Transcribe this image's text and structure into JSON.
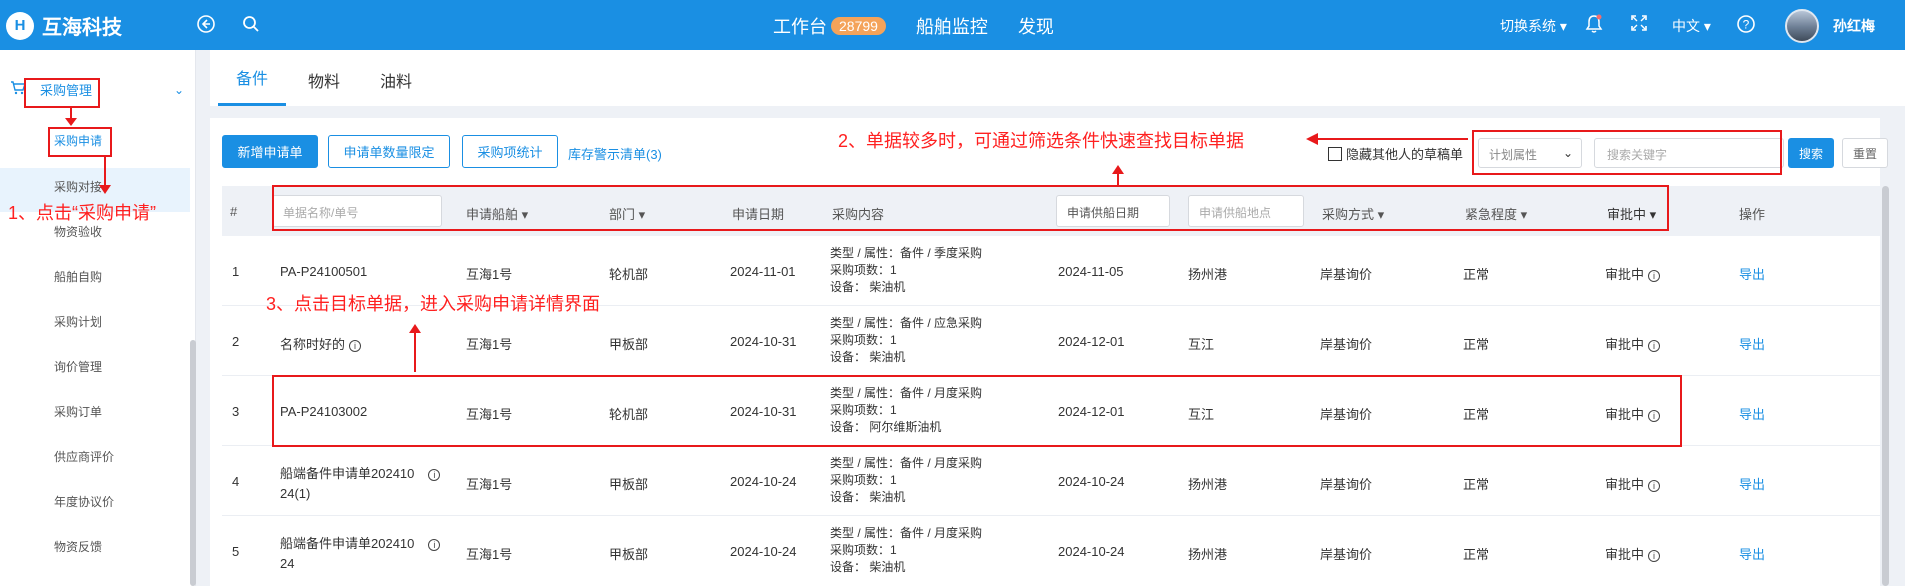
{
  "topbar": {
    "logo_mark": "H",
    "brand": "互海科技",
    "nav": [
      {
        "label": "工作台",
        "badge": "28799"
      },
      {
        "label": "船舶监控"
      },
      {
        "label": "发现"
      }
    ],
    "switch_system": "切换系统",
    "language": "中文",
    "user_name": "孙红梅",
    "colors": {
      "primary": "#1a8fe3",
      "annotation": "#e8191b"
    }
  },
  "sidebar": {
    "group_label": "采购管理",
    "items": [
      "采购申请",
      "采购对接",
      "物资验收",
      "船舶自购",
      "采购计划",
      "询价管理",
      "采购订单",
      "供应商评价",
      "年度协议价",
      "物资反馈"
    ]
  },
  "tabs": [
    "备件",
    "物料",
    "油料"
  ],
  "toolbar": {
    "new_request": "新增申请单",
    "limit": "申请单数量限定",
    "stats": "采购项统计",
    "warning_link": "库存警示清单(3)",
    "hide_drafts": "隐藏其他人的草稿单",
    "plan_attr": "计划属性",
    "keyword_placeholder": "搜索关键字",
    "search": "搜索",
    "reset": "重置"
  },
  "table": {
    "headers": {
      "num": "#",
      "name_placeholder": "单据名称/单号",
      "ship": "申请船舶",
      "dept": "部门",
      "date": "申请日期",
      "content": "采购内容",
      "supply_date": "申请供船日期",
      "supply_place": "申请供船地点",
      "method": "采购方式",
      "urgency": "紧急程度",
      "status": "审批中",
      "ops": "操作"
    },
    "rows": [
      {
        "num": "1",
        "name": "PA-P24100501",
        "name2": "",
        "info": false,
        "ship": "互海1号",
        "dept": "轮机部",
        "date": "2024-11-01",
        "c1": "类型 / 属性：备件 / 季度采购",
        "c2": "采购项数：1",
        "c3": "设备：  柴油机",
        "supply_date": "2024-11-05",
        "place": "扬州港",
        "method": "岸基询价",
        "urgency": "正常",
        "status": "审批中",
        "op": "导出"
      },
      {
        "num": "2",
        "name": "名称时好的",
        "name2": "",
        "info": true,
        "ship": "互海1号",
        "dept": "甲板部",
        "date": "2024-10-31",
        "c1": "类型 / 属性：备件 / 应急采购",
        "c2": "采购项数：1",
        "c3": "设备：  柴油机",
        "supply_date": "2024-12-01",
        "place": "互江",
        "method": "岸基询价",
        "urgency": "正常",
        "status": "审批中",
        "op": "导出"
      },
      {
        "num": "3",
        "name": "PA-P24103002",
        "name2": "",
        "info": false,
        "ship": "互海1号",
        "dept": "轮机部",
        "date": "2024-10-31",
        "c1": "类型 / 属性：备件 / 月度采购",
        "c2": "采购项数：1",
        "c3": "设备：  阿尔维斯油机",
        "supply_date": "2024-12-01",
        "place": "互江",
        "method": "岸基询价",
        "urgency": "正常",
        "status": "审批中",
        "op": "导出"
      },
      {
        "num": "4",
        "name": "船端备件申请单202410",
        "name2": "24(1)",
        "info": true,
        "ship": "互海1号",
        "dept": "甲板部",
        "date": "2024-10-24",
        "c1": "类型 / 属性：备件 / 月度采购",
        "c2": "采购项数：1",
        "c3": "设备：  柴油机",
        "supply_date": "2024-10-24",
        "place": "扬州港",
        "method": "岸基询价",
        "urgency": "正常",
        "status": "审批中",
        "op": "导出"
      },
      {
        "num": "5",
        "name": "船端备件申请单202410",
        "name2": "24",
        "info": true,
        "ship": "互海1号",
        "dept": "甲板部",
        "date": "2024-10-24",
        "c1": "类型 / 属性：备件 / 月度采购",
        "c2": "采购项数：1",
        "c3": "设备：  柴油机",
        "supply_date": "2024-10-24",
        "place": "扬州港",
        "method": "岸基询价",
        "urgency": "正常",
        "status": "审批中",
        "op": "导出"
      }
    ]
  },
  "annotations": {
    "step1": "1、点击“采购申请”",
    "step2": "2、单据较多时，可通过筛选条件快速查找目标单据",
    "step3": "3、点击目标单据，进入采购申请详情界面"
  }
}
